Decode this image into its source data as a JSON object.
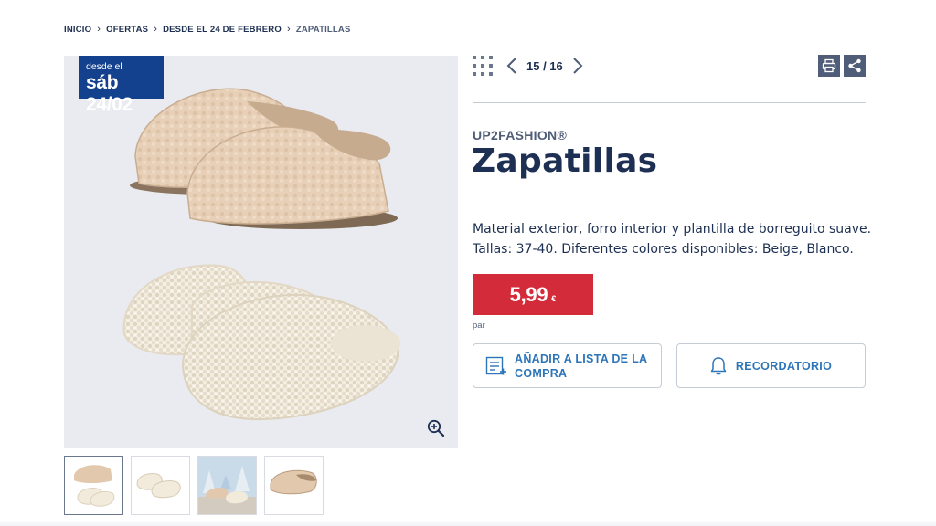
{
  "breadcrumb": {
    "items": [
      "INICIO",
      "OFERTAS",
      "DESDE EL 24 DE FEBRERO"
    ],
    "current": "ZAPATILLAS"
  },
  "badge": {
    "line1": "desde el",
    "line2": "sáb 24/02"
  },
  "pager": {
    "count": "15 / 16"
  },
  "product": {
    "brand": "UP2FASHION®",
    "title": "Zapatillas",
    "description_line1": "Material exterior, forro interior y plantilla de borreguito suave.",
    "description_line2": "Tallas: 37-40. Diferentes colores disponibles: Beige, Blanco.",
    "price": "5,99",
    "currency": "€",
    "per": "par"
  },
  "actions": {
    "list_label": "AÑADIR A LISTA DE LA COMPRA",
    "reminder_label": "RECORDATORIO"
  },
  "colors": {
    "navy": "#1d2f52",
    "badge_blue": "#14418e",
    "price_red": "#d42b3a",
    "link_blue": "#2c75b8",
    "tool_gray": "#4f5d78",
    "beige": "#e2c9ad",
    "cream": "#f2ebdc"
  },
  "icons": [
    "grid-icon",
    "chevron-left-icon",
    "chevron-right-icon",
    "print-icon",
    "share-icon",
    "zoom-in-icon",
    "list-add-icon",
    "bell-icon"
  ]
}
